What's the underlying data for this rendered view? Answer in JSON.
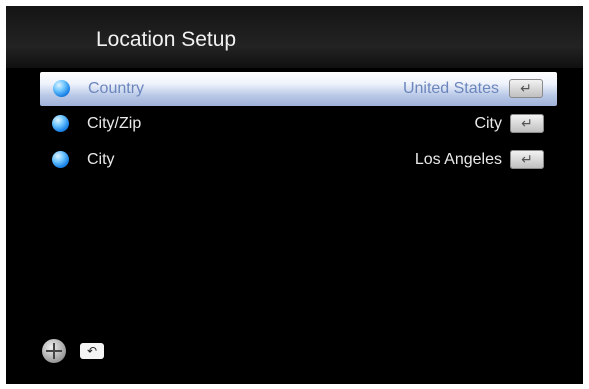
{
  "header": {
    "title": "Location Setup"
  },
  "menu": {
    "items": [
      {
        "label": "Country",
        "value": "United States",
        "icon": "globe-icon",
        "action_icon": "enter-key-icon",
        "selected": true
      },
      {
        "label": "City/Zip",
        "value": "City",
        "icon": "globe-icon",
        "action_icon": "enter-key-icon",
        "selected": false
      },
      {
        "label": "City",
        "value": "Los Angeles",
        "icon": "globe-icon",
        "action_icon": "enter-key-icon",
        "selected": false
      }
    ]
  },
  "footer": {
    "nav_icon": "dpad-icon",
    "back_icon": "return-icon"
  },
  "colors": {
    "background": "#000000",
    "highlight_top": "#ffffff",
    "highlight_bottom": "#9fb2d9",
    "selected_text": "#6b86bd",
    "text": "#e9e9e9"
  }
}
